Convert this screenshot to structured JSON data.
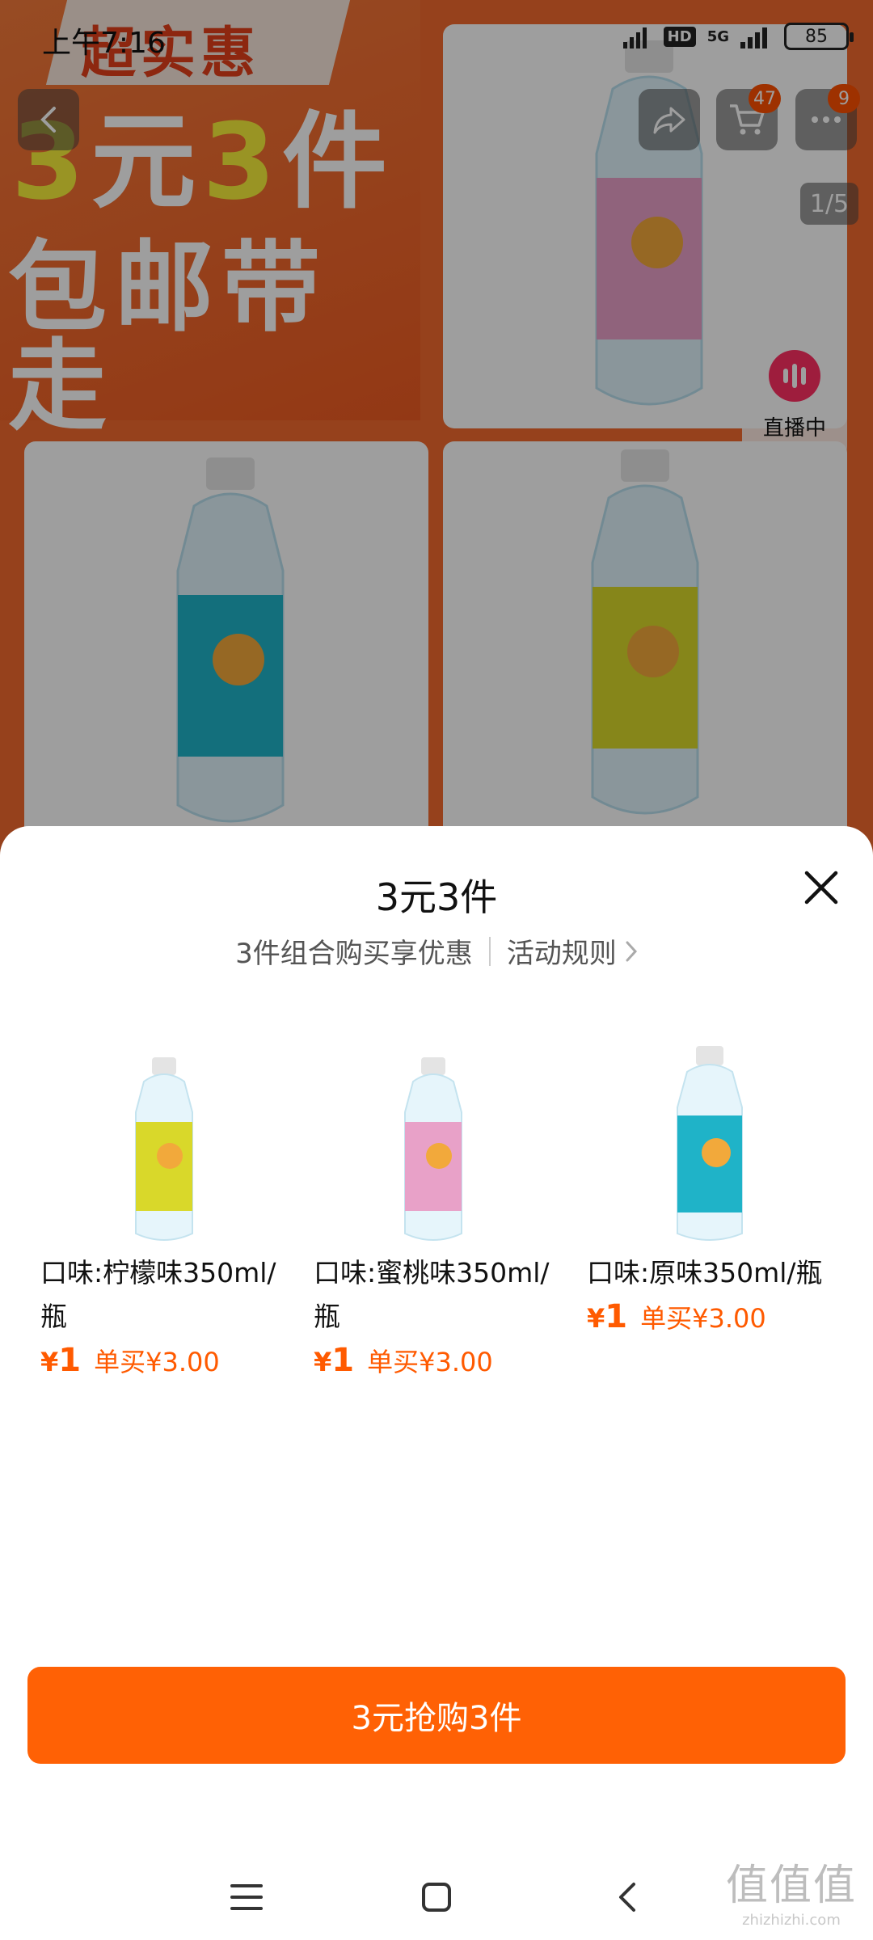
{
  "status_bar": {
    "time": "上午7:16",
    "network": "5G",
    "hd": "HD",
    "battery": "85"
  },
  "background_page": {
    "banner_ribbon": "超实惠",
    "banner_line1_a": "3",
    "banner_line1_b": "元",
    "banner_line1_c": "3",
    "banner_line1_d": "件",
    "banner_line2": "包邮带走",
    "cart_count": "47",
    "message_count": "9",
    "image_index": "1/5",
    "live_label": "直播中",
    "bottle_colors": {
      "peach": "#e8a1c8",
      "original": "#1fb3c8",
      "lemon": "#d9d82a"
    }
  },
  "sheet": {
    "title": "3元3件",
    "subtitle": "3件组合购买享优惠",
    "rules_link": "活动规则",
    "products": [
      {
        "name": "口味:柠檬味350ml/瓶",
        "price_symbol": "¥",
        "price": "1",
        "single_price": "单买¥3.00",
        "label_color": "#d9d82a"
      },
      {
        "name": "口味:蜜桃味350ml/瓶",
        "price_symbol": "¥",
        "price": "1",
        "single_price": "单买¥3.00",
        "label_color": "#e8a1c8"
      },
      {
        "name": "口味:原味350ml/瓶",
        "price_symbol": "¥",
        "price": "1",
        "single_price": "单买¥3.00",
        "label_color": "#1fb3c8"
      }
    ],
    "buy_button": "3元抢购3件"
  },
  "watermark": {
    "chars": "值值值",
    "domain": "zhizhizhi.com"
  },
  "colors": {
    "accent": "#ff6105",
    "price": "#ff5a00",
    "banner": "#f26a2e"
  }
}
